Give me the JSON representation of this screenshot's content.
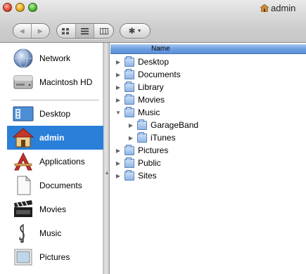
{
  "window": {
    "title": "admin"
  },
  "sidebar": {
    "items": [
      {
        "label": "Network",
        "icon": "network-globe-icon"
      },
      {
        "label": "Macintosh HD",
        "icon": "hard-disk-icon"
      },
      {
        "label": "Desktop",
        "icon": "desktop-folder-icon"
      },
      {
        "label": "admin",
        "icon": "home-icon",
        "selected": true
      },
      {
        "label": "Applications",
        "icon": "applications-icon"
      },
      {
        "label": "Documents",
        "icon": "document-icon"
      },
      {
        "label": "Movies",
        "icon": "film-clapper-icon"
      },
      {
        "label": "Music",
        "icon": "music-note-icon"
      },
      {
        "label": "Pictures",
        "icon": "picture-frame-icon"
      }
    ]
  },
  "list": {
    "column_header": "Name",
    "rows": [
      {
        "name": "Desktop",
        "expanded": false,
        "indent": 0
      },
      {
        "name": "Documents",
        "expanded": false,
        "indent": 0
      },
      {
        "name": "Library",
        "expanded": false,
        "indent": 0
      },
      {
        "name": "Movies",
        "expanded": false,
        "indent": 0
      },
      {
        "name": "Music",
        "expanded": true,
        "indent": 0
      },
      {
        "name": "GarageBand",
        "expanded": false,
        "indent": 1
      },
      {
        "name": "iTunes",
        "expanded": false,
        "indent": 1
      },
      {
        "name": "Pictures",
        "expanded": false,
        "indent": 0
      },
      {
        "name": "Public",
        "expanded": false,
        "indent": 0
      },
      {
        "name": "Sites",
        "expanded": false,
        "indent": 0
      }
    ]
  },
  "colors": {
    "selection": "#2a7fd9",
    "header": "#6e9fe0",
    "folder": "#8fb5e4"
  }
}
